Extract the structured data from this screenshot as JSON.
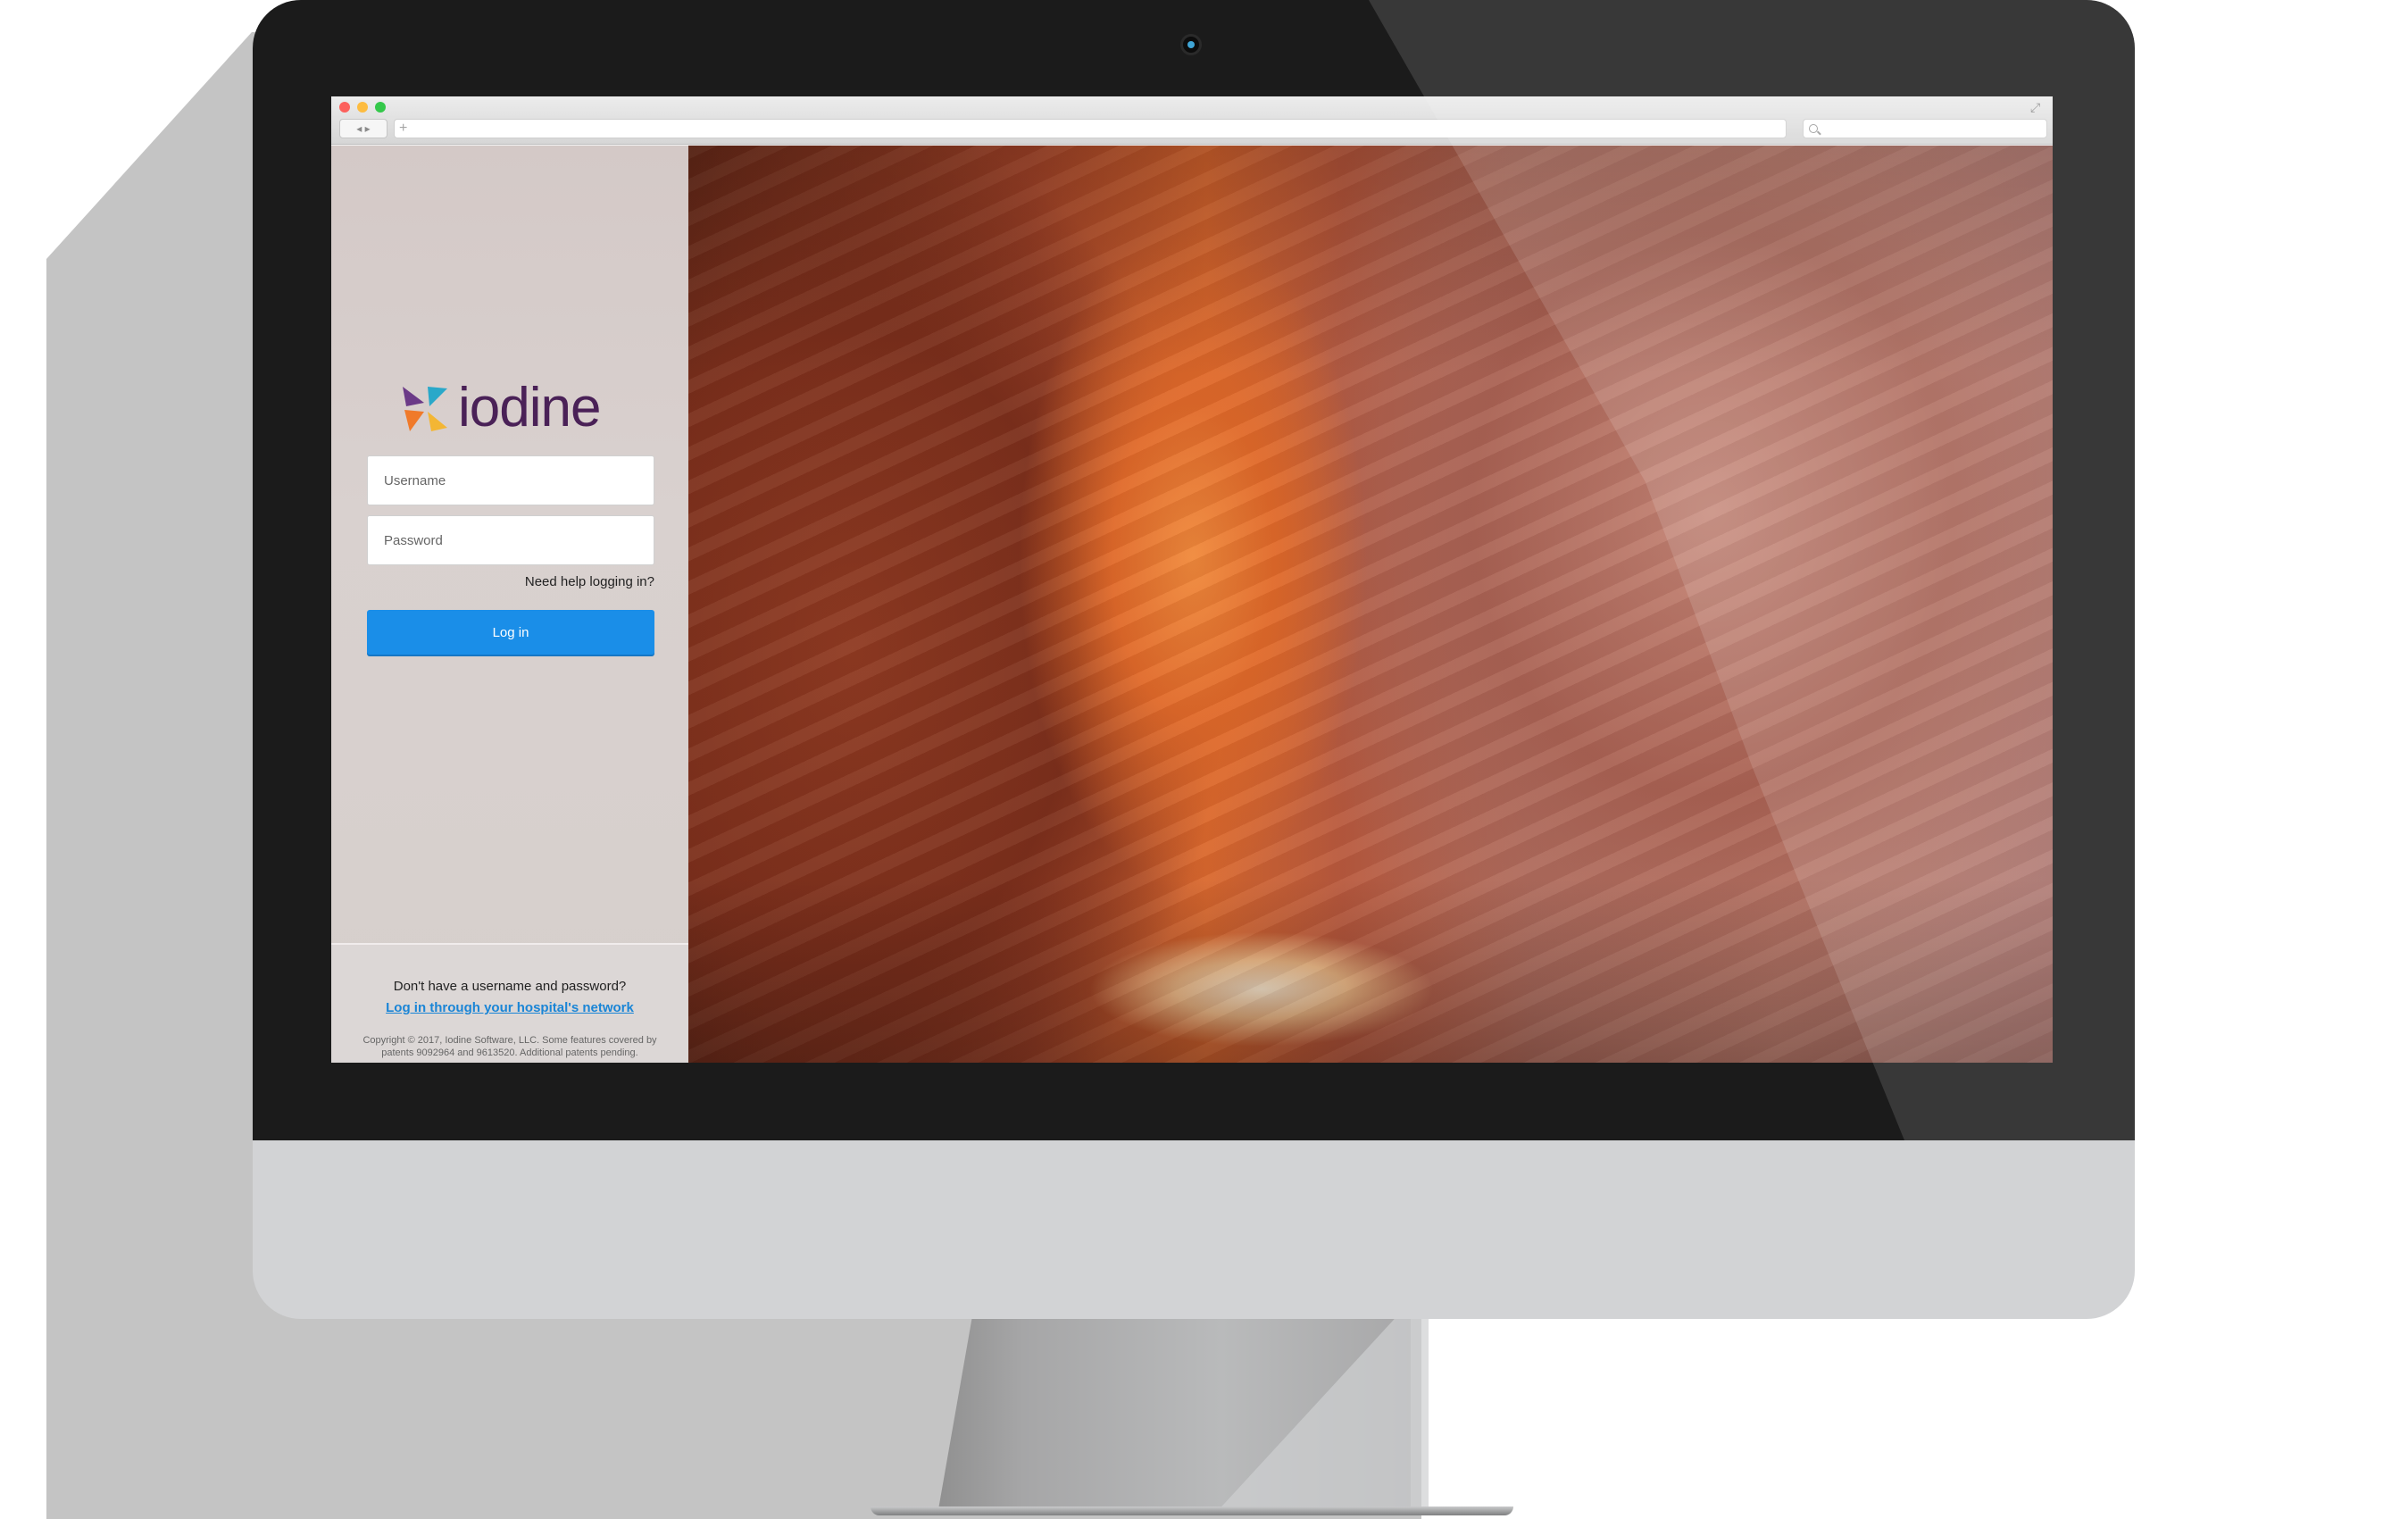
{
  "browser": {
    "nav_buttons": "◂ ▸",
    "url_plus": "+",
    "icons": [
      "close-icon",
      "minimize-icon",
      "zoom-icon",
      "search-icon",
      "expand-icon"
    ]
  },
  "login": {
    "brand": "iodine",
    "username_placeholder": "Username",
    "password_placeholder": "Password",
    "help_link": "Need help logging in?",
    "login_button": "Log in",
    "no_account_text": "Don't have a username and password?",
    "network_link": "Log in through your hospital's network",
    "copyright": "Copyright © 2017, Iodine Software, LLC. Some features covered by patents 9092964 and 9613520. Additional patents pending."
  },
  "colors": {
    "brand_purple": "#4a2157",
    "login_button": "#1a8ee8",
    "link_blue": "#1a85d6"
  }
}
